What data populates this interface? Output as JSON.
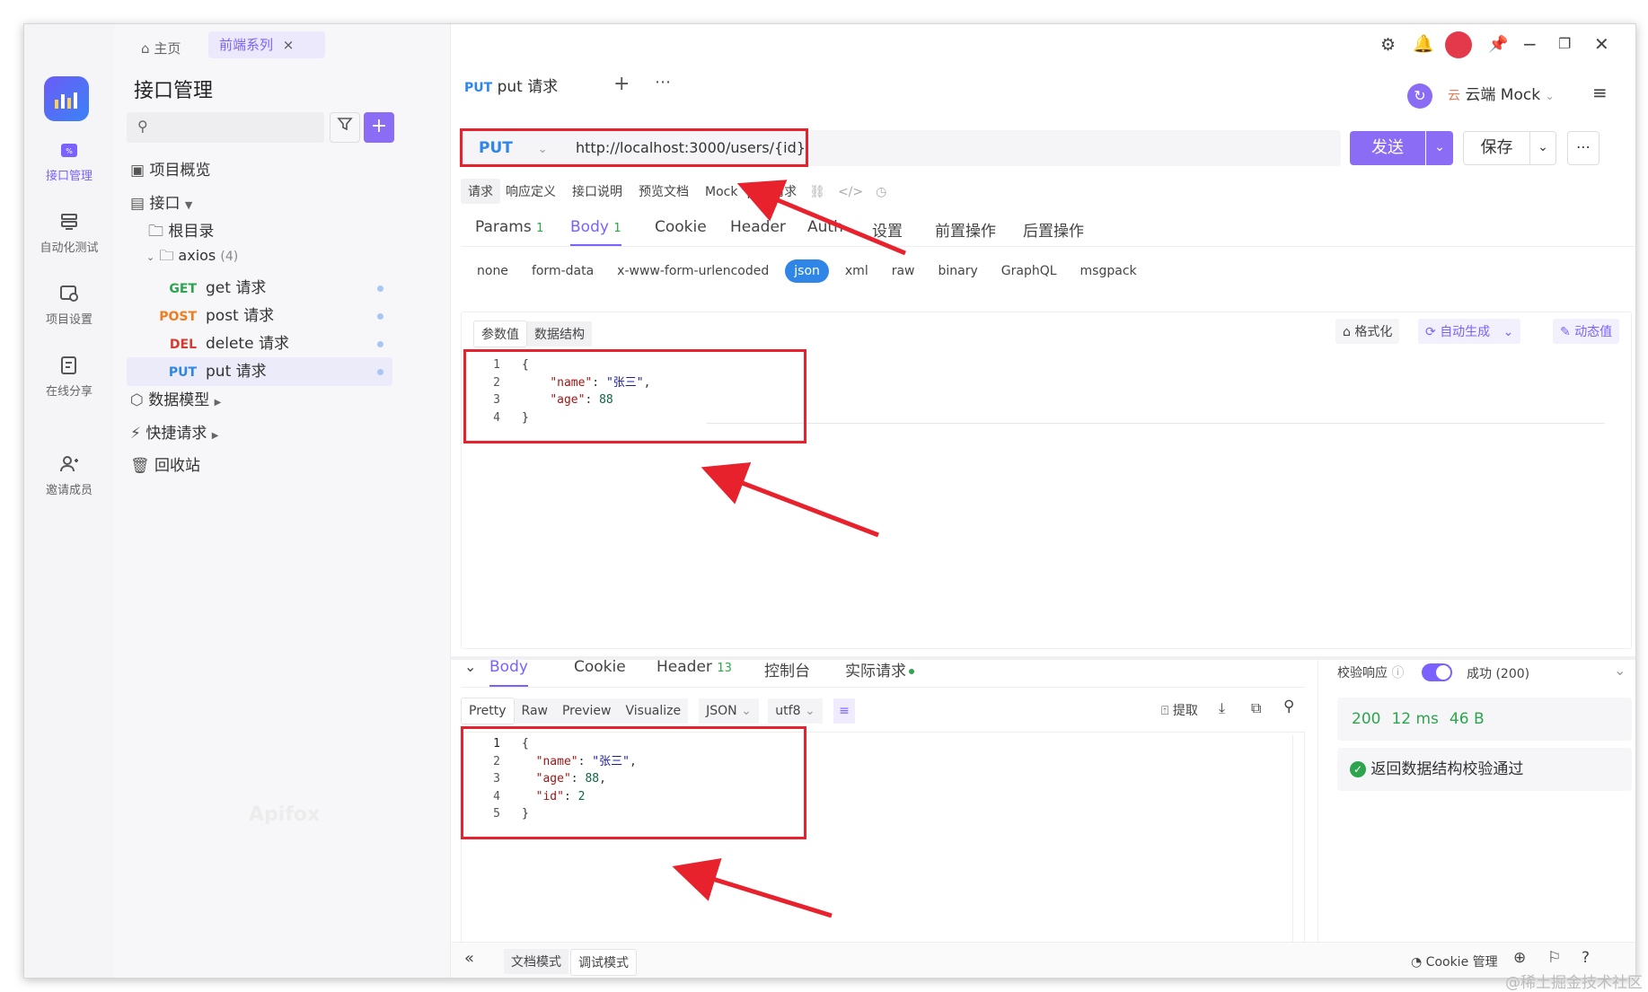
{
  "titlebar": {
    "home_tab": "主页",
    "project_tab": "前端系列",
    "close_glyph": "×"
  },
  "rail": [
    {
      "label": "接口管理",
      "icon": "api-icon",
      "active": true
    },
    {
      "label": "自动化测试",
      "icon": "automation-icon",
      "active": false
    },
    {
      "label": "项目设置",
      "icon": "settings-icon",
      "active": false
    },
    {
      "label": "在线分享",
      "icon": "share-icon",
      "active": false
    },
    {
      "label": "邀请成员",
      "icon": "invite-icon",
      "active": false
    }
  ],
  "sidebar": {
    "title": "接口管理",
    "overview": "项目概览",
    "api_group": "接口",
    "root_dir": "根目录",
    "folder": "axios",
    "folder_count": "(4)",
    "items": [
      {
        "method": "GET",
        "name": "get 请求",
        "color": "#2ea44f"
      },
      {
        "method": "POST",
        "name": "post 请求",
        "color": "#f07c1b"
      },
      {
        "method": "DEL",
        "name": "delete 请求",
        "color": "#d63b2f"
      },
      {
        "method": "PUT",
        "name": "put 请求",
        "color": "#2f86e6"
      }
    ],
    "data_model": "数据模型",
    "quick_request": "快捷请求",
    "recycle": "回收站",
    "watermark": "Apifox"
  },
  "editor": {
    "tab_method": "PUT",
    "tab_name": "put 请求",
    "env_label": "云端 Mock",
    "method": "PUT",
    "url": "http://localhost:3000/users/{id}",
    "send": "发送",
    "save": "保存",
    "subtabs": [
      "请求",
      "响应定义",
      "接口说明",
      "预览文档",
      "Mock",
      "put 请求"
    ],
    "req_tabs": [
      {
        "label": "Params",
        "count": "1"
      },
      {
        "label": "Body",
        "count": "1"
      },
      {
        "label": "Cookie",
        "count": ""
      },
      {
        "label": "Header",
        "count": ""
      },
      {
        "label": "Auth",
        "count": ""
      },
      {
        "label": "设置",
        "count": ""
      },
      {
        "label": "前置操作",
        "count": ""
      },
      {
        "label": "后置操作",
        "count": ""
      }
    ],
    "body_types": [
      "none",
      "form-data",
      "x-www-form-urlencoded",
      "json",
      "xml",
      "raw",
      "binary",
      "GraphQL",
      "msgpack"
    ],
    "body_subtabs": [
      "参数值",
      "数据结构"
    ],
    "format_btn": "格式化",
    "autogen_btn": "自动生成",
    "dynamic_btn": "动态值",
    "request_lines": [
      {
        "no": "1",
        "text": "{"
      },
      {
        "no": "2",
        "key": "\"name\"",
        "val": "\"张三\"",
        "tail": ","
      },
      {
        "no": "3",
        "key": "\"age\"",
        "val": "88",
        "tail": ""
      },
      {
        "no": "4",
        "text": "}"
      }
    ]
  },
  "response": {
    "tabs": [
      {
        "label": "Body",
        "count": ""
      },
      {
        "label": "Cookie",
        "count": ""
      },
      {
        "label": "Header",
        "count": "13"
      },
      {
        "label": "控制台",
        "count": ""
      },
      {
        "label": "实际请求",
        "count": ""
      }
    ],
    "views": [
      "Pretty",
      "Raw",
      "Preview",
      "Visualize"
    ],
    "format": "JSON",
    "encoding": "utf8",
    "extract": "提取",
    "lines": [
      {
        "no": "1",
        "text": "{"
      },
      {
        "no": "2",
        "key": "\"name\"",
        "val": "\"张三\"",
        "tail": ","
      },
      {
        "no": "3",
        "key": "\"age\"",
        "val": "88",
        "tail": ","
      },
      {
        "no": "4",
        "key": "\"id\"",
        "val": "2",
        "tail": ""
      },
      {
        "no": "5",
        "text": "}"
      }
    ],
    "validate_label": "校验响应",
    "validate_result": "成功 (200)",
    "status": "200",
    "time": "12 ms",
    "size": "46 B",
    "validation_msg": "返回数据结构校验通过"
  },
  "footer": {
    "doc_mode": "文档模式",
    "debug_mode": "调试模式",
    "cookie_mgmt": "Cookie 管理"
  },
  "site_watermark": "@稀土掘金技术社区",
  "colors": {
    "accent": "#7b61ff",
    "annotation_red": "#e8222d"
  }
}
